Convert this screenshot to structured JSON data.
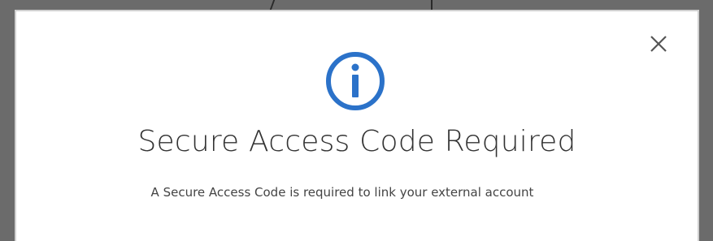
{
  "modal": {
    "title": "Secure Access Code Required",
    "message": "A Secure Access Code is required to link your external account",
    "icon": "info-circle-icon",
    "close_icon": "close-icon"
  },
  "colors": {
    "accent": "#2b72c9",
    "title": "#333333",
    "backdrop": "#6b6b6b"
  }
}
